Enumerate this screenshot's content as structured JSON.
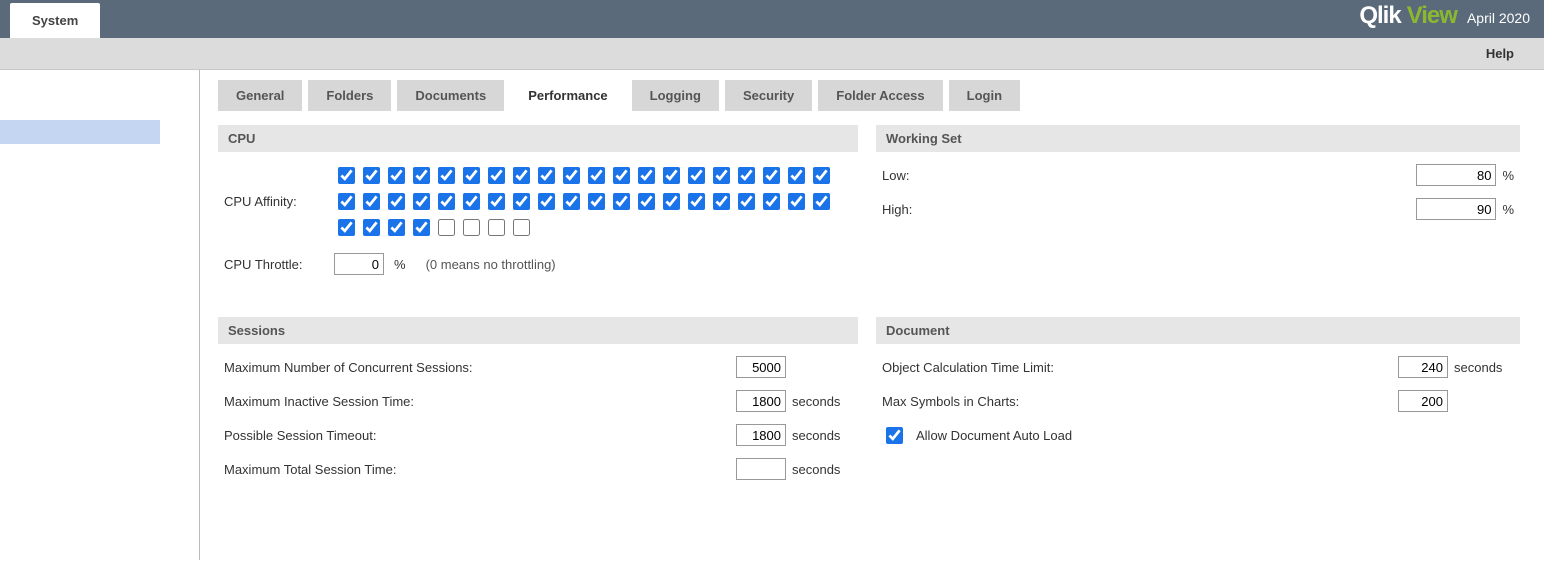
{
  "header": {
    "system_tab": "System",
    "brand_qlik": "Qlik",
    "brand_view": "View",
    "brand_date": "April 2020",
    "help": "Help"
  },
  "tabs": [
    {
      "label": "General",
      "active": false
    },
    {
      "label": "Folders",
      "active": false
    },
    {
      "label": "Documents",
      "active": false
    },
    {
      "label": "Performance",
      "active": true
    },
    {
      "label": "Logging",
      "active": false
    },
    {
      "label": "Security",
      "active": false
    },
    {
      "label": "Folder Access",
      "active": false
    },
    {
      "label": "Login",
      "active": false
    }
  ],
  "cpu": {
    "title": "CPU",
    "affinity_label": "CPU Affinity:",
    "affinity": [
      true,
      true,
      true,
      true,
      true,
      true,
      true,
      true,
      true,
      true,
      true,
      true,
      true,
      true,
      true,
      true,
      true,
      true,
      true,
      true,
      true,
      true,
      true,
      true,
      true,
      true,
      true,
      true,
      true,
      true,
      true,
      true,
      true,
      true,
      true,
      true,
      true,
      true,
      true,
      true,
      true,
      true,
      true,
      true,
      false,
      false,
      false,
      false
    ],
    "throttle_label": "CPU Throttle:",
    "throttle_value": "0",
    "throttle_unit": "%",
    "throttle_hint": "(0 means no throttling)"
  },
  "working_set": {
    "title": "Working Set",
    "low_label": "Low:",
    "low_value": "80",
    "high_label": "High:",
    "high_value": "90",
    "unit": "%"
  },
  "sessions": {
    "title": "Sessions",
    "rows": [
      {
        "label": "Maximum Number of Concurrent Sessions:",
        "value": "5000",
        "unit": ""
      },
      {
        "label": "Maximum Inactive Session Time:",
        "value": "1800",
        "unit": "seconds"
      },
      {
        "label": "Possible Session Timeout:",
        "value": "1800",
        "unit": "seconds"
      },
      {
        "label": "Maximum Total Session Time:",
        "value": "",
        "unit": "seconds"
      }
    ]
  },
  "document": {
    "title": "Document",
    "rows": [
      {
        "label": "Object Calculation Time Limit:",
        "value": "240",
        "unit": "seconds"
      },
      {
        "label": "Max Symbols in Charts:",
        "value": "200",
        "unit": ""
      }
    ],
    "allow_auto_load_label": "Allow Document Auto Load",
    "allow_auto_load": true
  }
}
